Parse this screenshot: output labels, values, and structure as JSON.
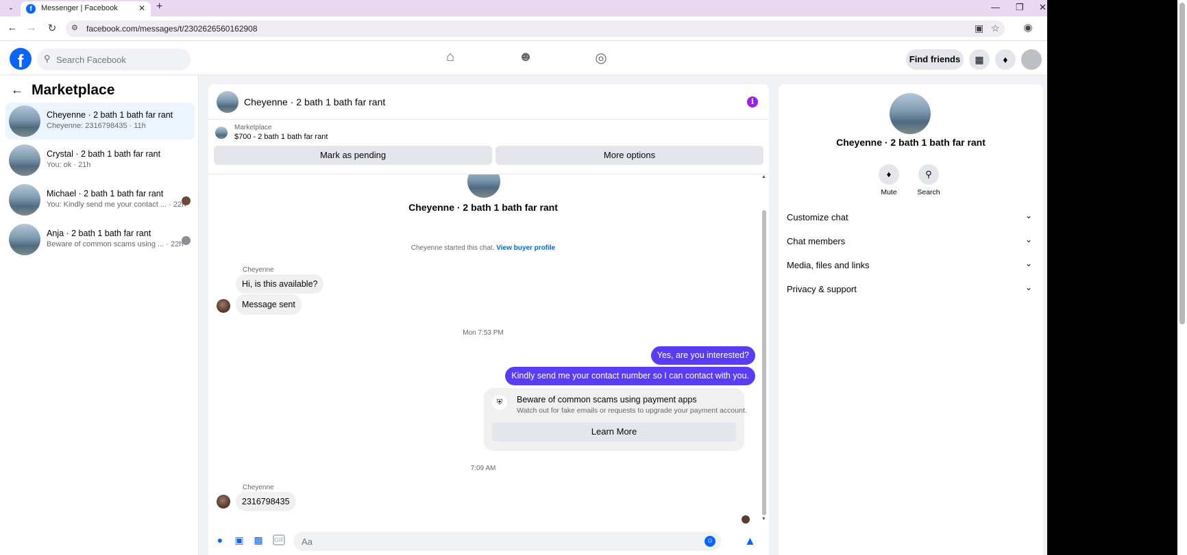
{
  "browser": {
    "tab_title": "Messenger | Facebook",
    "url": "facebook.com/messages/t/23026265601629​08"
  },
  "fb": {
    "search_placeholder": "Search Facebook",
    "find_friends": "Find friends"
  },
  "sidebar": {
    "title": "Marketplace",
    "conversations": [
      {
        "name": "Cheyenne · 2 bath 1 bath far rant",
        "sub": "Cheyenne: 2316798435 · 11h",
        "active": true
      },
      {
        "name": "Crystal · 2 bath 1 bath far rant",
        "sub": "You: ok · 21h",
        "active": false
      },
      {
        "name": "Michael · 2 bath 1 bath far rant",
        "sub": "You: Kindly send me your contact ... · 22h",
        "active": false
      },
      {
        "name": "Anja · 2 bath 1 bath far rant",
        "sub": "Beware of common scams using ... · 22h",
        "active": false
      }
    ]
  },
  "chat": {
    "title": "Cheyenne · 2 bath 1 bath far rant",
    "marketplace_label": "Marketplace",
    "listing": "$700 - 2 bath 1 bath far rant",
    "mark_pending": "Mark as pending",
    "more_options": "More options",
    "center_title": "Cheyenne · 2 bath 1 bath far rant",
    "started_text": "Cheyenne started this chat.",
    "view_buyer_profile": "View buyer profile",
    "sender": "Cheyenne",
    "msg_in_1": "Hi, is this available?",
    "msg_in_2": "Message sent",
    "stamp_1": "Mon 7:53 PM",
    "msg_out_1": "Yes, are you interested?",
    "msg_out_2": "Kindly send me your contact number so I can contact with you.",
    "scam_title": "Beware of common scams using payment apps",
    "scam_text": "Watch out for fake emails or requests to upgrade your payment account.",
    "learn_more": "Learn More",
    "stamp_2": "7:09 AM",
    "msg_in_3": "2316798435",
    "composer_placeholder": "Aa"
  },
  "info": {
    "name": "Cheyenne · 2 bath 1 bath far rant",
    "mute": "Mute",
    "search": "Search",
    "sections": [
      "Customize chat",
      "Chat members",
      "Media, files and links",
      "Privacy & support"
    ]
  },
  "colors": {
    "fb_blue": "#0866ff",
    "outgoing_bubble": "#5b3cf6",
    "info_icon": "#9b1fe8",
    "active_conv": "#ebf5ff"
  }
}
